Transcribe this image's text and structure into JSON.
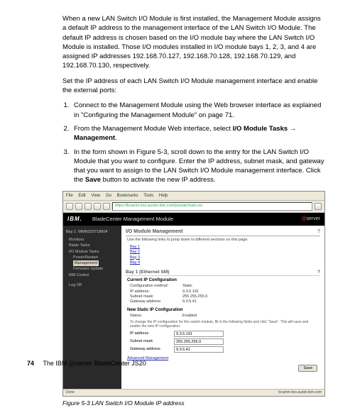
{
  "intro1": "When a new LAN Switch I/O Module is first installed, the Management Module assigns a default IP address to the management interface of the LAN Switch I/O Module. The default IP address is chosen based on the I/O module bay where the LAN Switch I/O Module is installed. Those I/O modules installed in I/O module bays 1, 2, 3, and 4 are assigned IP addresses 192.168.70.127, 192.168.70.128, 192.168.70.129, and 192.168.70.130, respectively.",
  "intro2": "Set the IP address of each LAN Switch I/O Module management interface and enable the external ports:",
  "steps": {
    "s1": "Connect to the Management Module using the Web browser interface as explained in \"Configuring the Management Module\" on page 71.",
    "s2a": "From the Management Module Web interface, select ",
    "s2b": "I/O Module Tasks",
    "s2c": " → ",
    "s2d": "Management",
    "s2e": ".",
    "s3a": "In the form shown in Figure 5-3, scroll down to the entry for the LAN Switch I/O Module that you want to configure. Enter the IP address, subnet mask, and gateway that you want to assign to the LAN Switch I/O Module management interface. Click the ",
    "s3b": "Save",
    "s3c": " button to activate the new IP address."
  },
  "browser": {
    "menus": [
      "File",
      "Edit",
      "View",
      "Go",
      "Bookmarks",
      "Tools",
      "Help"
    ],
    "url": "https://bcamm.itso.austin.ibm.com/private/main.ssi"
  },
  "banner": {
    "logo": "IBM.",
    "title": "BladeCenter Management Module",
    "server": "server"
  },
  "sidebar": {
    "bay": "Bay 1: WMN315718604",
    "groups": [
      {
        "label": "Monitors",
        "items": []
      },
      {
        "label": "Blade Tasks",
        "items": []
      },
      {
        "label": "I/O Module Tasks",
        "items": [
          "Power/Restart",
          "Management",
          "Firmware Update"
        ]
      },
      {
        "label": "MM Control",
        "items": []
      }
    ],
    "logoff": "Log Off"
  },
  "panel": {
    "title": "I/O Module Management",
    "jump_text": "Use the following links to jump down to different sections on this page.",
    "bay_links": [
      "Bay 1",
      "Bay 2",
      "Bay 3",
      "Bay 4"
    ],
    "bay_title": "Bay 1 (Ethernet SM)",
    "current_head": "Current IP Configuration",
    "current": {
      "method_k": "Configuration method:",
      "method_v": "Static",
      "ip_k": "IP address:",
      "ip_v": "9.3.5.191",
      "mask_k": "Subnet mask:",
      "mask_v": "255.255.255.0",
      "gw_k": "Gateway address:",
      "gw_v": "9.3.5.41"
    },
    "new_head": "New Static IP Configuration",
    "status_k": "Status:",
    "status_v": "Enabled",
    "note": "To change the IP configuration for this switch module, fill in the following fields and click \"Save\". This will save and enable the new IP configuration.",
    "form": {
      "ip_l": "IP address",
      "ip_v": "9.3.5.191",
      "mask_l": "Subnet mask",
      "mask_v": "255.255.255.0",
      "gw_l": "Gateway address",
      "gw_v": "9.3.5.41"
    },
    "adv": "Advanced Management",
    "save": "Save"
  },
  "statusbar": {
    "left": "Done",
    "right": "bcamm.itso.austin.ibm.com"
  },
  "figure": "Figure 5-3   LAN Switch I/O Module IP address",
  "footer": {
    "page": "74",
    "title_a": "The IBM ",
    "title_b": "server BladeCenter JS20"
  }
}
